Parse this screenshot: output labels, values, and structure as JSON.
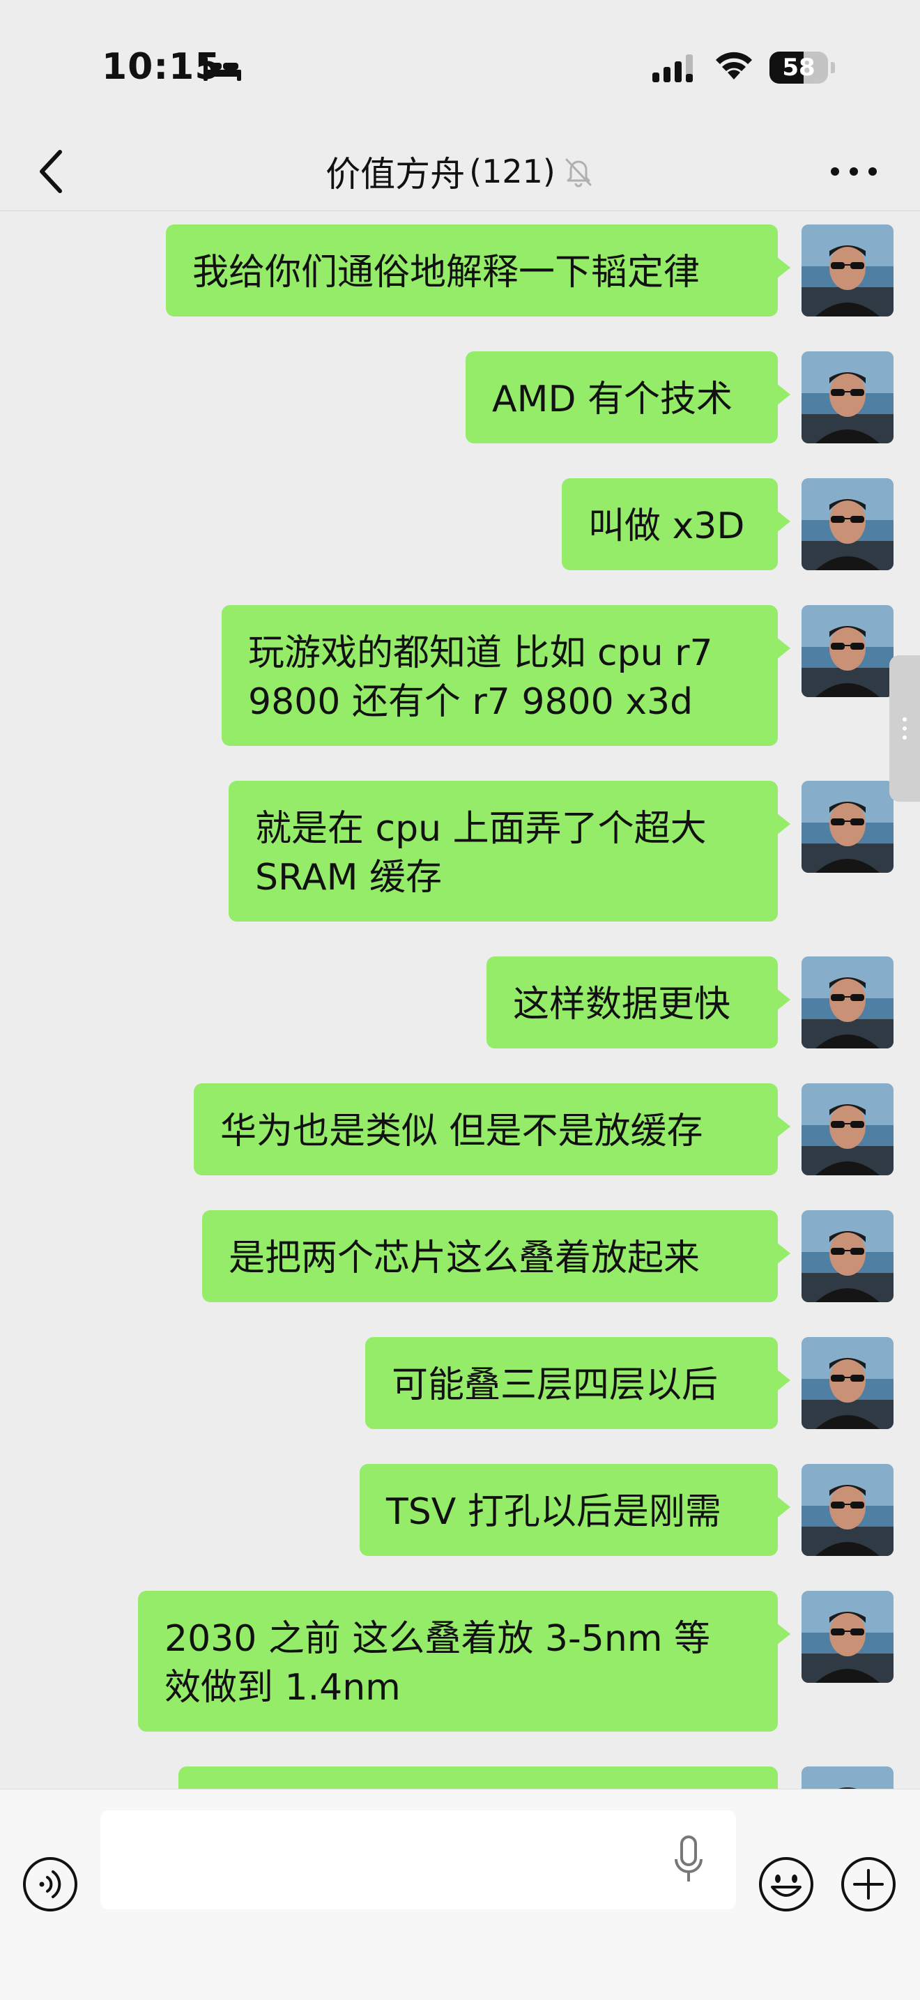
{
  "status": {
    "time": "10:15",
    "battery_level": "58",
    "battery_fraction": 0.58
  },
  "chat": {
    "title": "价值方舟",
    "member_count": "(121)"
  },
  "icons": {
    "back": "chevron-left-icon",
    "mute": "bell-slash-icon",
    "more": "more-dots-icon",
    "voice": "voice-icon",
    "mic": "microphone-icon",
    "emoji": "emoji-icon",
    "plus": "plus-icon"
  },
  "colors": {
    "bubble": "#95ec69",
    "background": "#ededed"
  },
  "messages": [
    {
      "text": "我给你们通俗地解释一下韬定律"
    },
    {
      "text": "AMD 有个技术"
    },
    {
      "text": "叫做 x3D"
    },
    {
      "text": "玩游戏的都知道 比如 cpu r7\n9800 还有个 r7 9800 x3d"
    },
    {
      "text": "就是在 cpu 上面弄了个超大\nSRAM 缓存"
    },
    {
      "text": "这样数据更快"
    },
    {
      "text": "华为也是类似 但是不是放缓存"
    },
    {
      "text": "是把两个芯片这么叠着放起来"
    },
    {
      "text": "可能叠三层四层以后"
    },
    {
      "text": "TSV 打孔以后是刚需"
    },
    {
      "text": "2030 之前 这么叠着放 3-5nm 等\n效做到 1.4nm"
    }
  ],
  "input": {
    "value": "",
    "placeholder": ""
  }
}
